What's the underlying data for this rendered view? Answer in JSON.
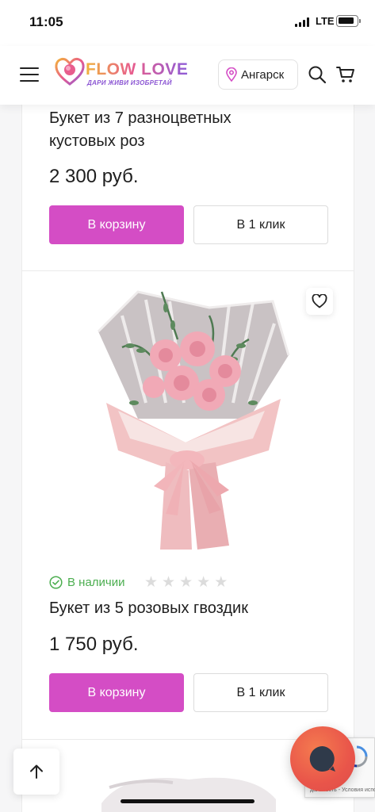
{
  "status_bar": {
    "time": "11:05",
    "network": "LTE"
  },
  "header": {
    "logo_name": "FLOW LOVE",
    "logo_tagline": "ДАРИ ЖИВИ ИЗОБРЕТАЙ",
    "city": "Ангарск"
  },
  "products": [
    {
      "title_line1": "Букет из 7 разноцветных",
      "title_line2": "кустовых роз",
      "price": "2 300 руб.",
      "cart_label": "В корзину",
      "one_click_label": "В 1 клик"
    },
    {
      "availability": "В наличии",
      "rating": 0,
      "rating_max": 5,
      "title": "Букет из 5 розовых гвоздик",
      "price": "1 750 руб.",
      "cart_label": "В корзину",
      "one_click_label": "В 1 клик"
    }
  ],
  "recaptcha": {
    "text": "дальность - Условия использования"
  },
  "colors": {
    "primary_button": "#d44dc5",
    "availability": "#4cae50",
    "chat_button": "#e9554a"
  }
}
